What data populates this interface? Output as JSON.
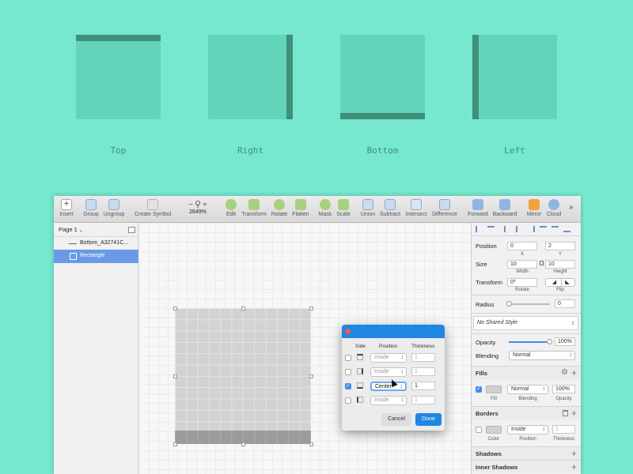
{
  "demos": [
    {
      "label": "Top"
    },
    {
      "label": "Right"
    },
    {
      "label": "Bottom"
    },
    {
      "label": "Left"
    }
  ],
  "colors": {
    "background": "#75e8cf",
    "square": "#62d4b9",
    "border": "#3f8f7b",
    "accent": "#3d8ff0"
  },
  "toolbar": {
    "insert": "Insert",
    "group": "Group",
    "ungroup": "Ungroup",
    "create_symbol": "Create Symbol",
    "zoom": "2649%",
    "edit": "Edit",
    "transform": "Transform",
    "rotate": "Rotate",
    "flatten": "Flatten",
    "mask": "Mask",
    "scale": "Scale",
    "union": "Union",
    "subtract": "Subtract",
    "intersect": "Intersect",
    "difference": "Difference",
    "forward": "Forward",
    "backward": "Backward",
    "mirror": "Mirror",
    "cloud": "Cloud",
    "overflow": "»"
  },
  "layers": {
    "page": "Page 1",
    "items": [
      {
        "name": "Bottom_A32741C..."
      },
      {
        "name": "Rectangle"
      }
    ]
  },
  "inspector": {
    "position_label": "Position",
    "x": "0",
    "y": "2",
    "x_label": "X",
    "y_label": "Y",
    "size_label": "Size",
    "width": "10",
    "height": "10",
    "width_label": "Width",
    "height_label": "Height",
    "transform_label": "Transform",
    "rotate": "0º",
    "rotate_label": "Rotate",
    "flip_label": "Flip",
    "radius_label": "Radius",
    "radius": "0",
    "shared_style": "No Shared Style",
    "opacity_label": "Opacity",
    "opacity": "100%",
    "opacity_level": 1,
    "blending_label": "Blending",
    "blending": "Normal",
    "fills": {
      "title": "Fills",
      "blend": "Normal",
      "opacity": "100%",
      "fill_label": "Fill",
      "blending_label": "Blending",
      "opacity_label": "Opacity"
    },
    "borders": {
      "title": "Borders",
      "position": "Inside",
      "thickness": "1",
      "color_label": "Color",
      "position_label": "Position",
      "thickness_label": "Thickness"
    },
    "shadows": "Shadows",
    "inner_shadows": "Inner Shadows"
  },
  "dialog": {
    "headers": {
      "side": "Side",
      "position": "Position",
      "thickness": "Thickness"
    },
    "rows": [
      {
        "position": "Inside",
        "thickness": "1",
        "checked": false
      },
      {
        "position": "Inside",
        "thickness": "1",
        "checked": false
      },
      {
        "position": "Center",
        "thickness": "1",
        "checked": true
      },
      {
        "position": "Inside",
        "thickness": "1",
        "checked": false
      }
    ],
    "cancel": "Cancel",
    "done": "Done"
  }
}
